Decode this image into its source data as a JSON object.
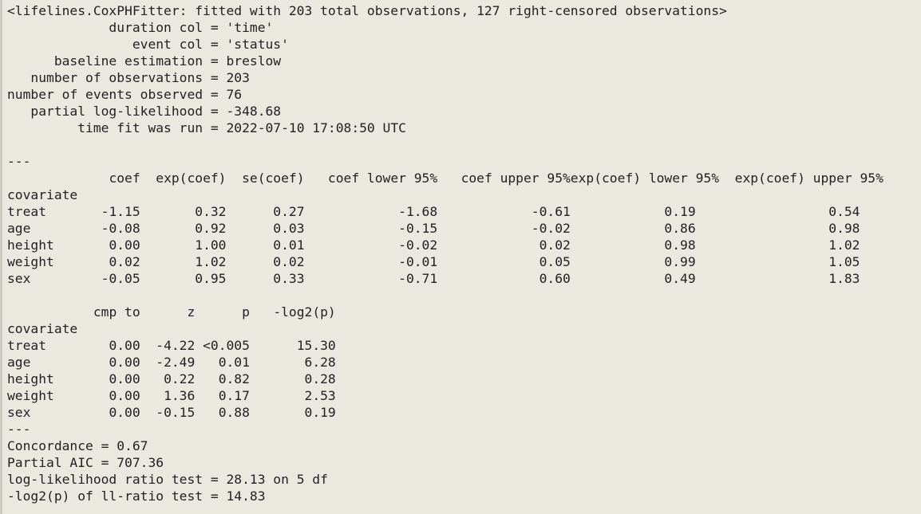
{
  "summary": {
    "header": "<lifelines.CoxPHFitter: fitted with 203 total observations, 127 right-censored observations>",
    "info": [
      {
        "key": "duration col",
        "value": "'time'"
      },
      {
        "key": "event col",
        "value": "'status'"
      },
      {
        "key": "baseline estimation",
        "value": "breslow"
      },
      {
        "key": "number of observations",
        "value": "203"
      },
      {
        "key": "number of events observed",
        "value": "76"
      },
      {
        "key": "partial log-likelihood",
        "value": "-348.68"
      },
      {
        "key": "time fit was run",
        "value": "2022-07-10 17:08:50 UTC"
      }
    ],
    "separator": "---",
    "index_name": "covariate",
    "table1": {
      "columns": [
        "coef",
        "exp(coef)",
        "se(coef)",
        "coef lower 95%",
        "coef upper 95%",
        "exp(coef) lower 95%",
        "exp(coef) upper 95%"
      ],
      "rows": [
        {
          "name": "treat",
          "values": [
            "-1.15",
            "0.32",
            "0.27",
            "-1.68",
            "-0.61",
            "0.19",
            "0.54"
          ]
        },
        {
          "name": "age",
          "values": [
            "-0.08",
            "0.92",
            "0.03",
            "-0.15",
            "-0.02",
            "0.86",
            "0.98"
          ]
        },
        {
          "name": "height",
          "values": [
            "0.00",
            "1.00",
            "0.01",
            "-0.02",
            "0.02",
            "0.98",
            "1.02"
          ]
        },
        {
          "name": "weight",
          "values": [
            "0.02",
            "1.02",
            "0.02",
            "-0.01",
            "0.05",
            "0.99",
            "1.05"
          ]
        },
        {
          "name": "sex",
          "values": [
            "-0.05",
            "0.95",
            "0.33",
            "-0.71",
            "0.60",
            "0.49",
            "1.83"
          ]
        }
      ]
    },
    "table2": {
      "columns": [
        "cmp to",
        "z",
        "p",
        "-log2(p)"
      ],
      "rows": [
        {
          "name": "treat",
          "values": [
            "0.00",
            "-4.22",
            "<0.005",
            "15.30"
          ]
        },
        {
          "name": "age",
          "values": [
            "0.00",
            "-2.49",
            "0.01",
            "6.28"
          ]
        },
        {
          "name": "height",
          "values": [
            "0.00",
            "0.22",
            "0.82",
            "0.28"
          ]
        },
        {
          "name": "weight",
          "values": [
            "0.00",
            "1.36",
            "0.17",
            "2.53"
          ]
        },
        {
          "name": "sex",
          "values": [
            "0.00",
            "-0.15",
            "0.88",
            "0.19"
          ]
        }
      ]
    },
    "footer": [
      {
        "key": "Concordance",
        "value": "0.67"
      },
      {
        "key": "Partial AIC",
        "value": "707.36"
      },
      {
        "key": "log-likelihood ratio test",
        "value": "28.13 on 5 df"
      },
      {
        "key": "-log2(p) of ll-ratio test",
        "value": "14.83"
      }
    ]
  }
}
